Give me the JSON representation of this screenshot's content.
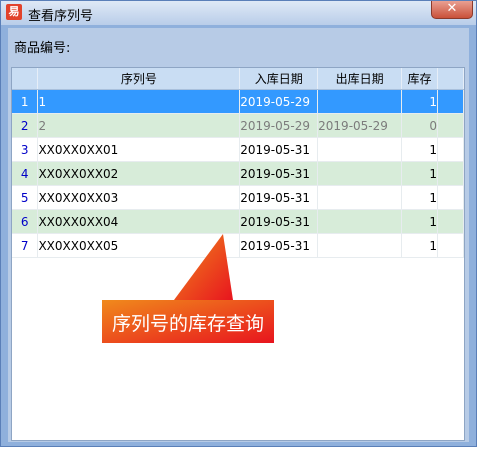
{
  "window": {
    "title": "查看序列号",
    "app_icon_glyph": "易",
    "close_glyph": "✕"
  },
  "form": {
    "product_label": "商品编号:"
  },
  "grid": {
    "columns": [
      "",
      "序列号",
      "入库日期",
      "出库日期",
      "库存"
    ],
    "rows": [
      {
        "index": "1",
        "serial": "1",
        "in_date": "2019-05-29",
        "out_date": "",
        "stock": "1",
        "state": "selected"
      },
      {
        "index": "2",
        "serial": "2",
        "in_date": "2019-05-29",
        "out_date": "2019-05-29",
        "stock": "0",
        "state": "dim-alt"
      },
      {
        "index": "3",
        "serial": "XX0XX0XX01",
        "in_date": "2019-05-31",
        "out_date": "",
        "stock": "1",
        "state": "normal"
      },
      {
        "index": "4",
        "serial": "XX0XX0XX02",
        "in_date": "2019-05-31",
        "out_date": "",
        "stock": "1",
        "state": "alt"
      },
      {
        "index": "5",
        "serial": "XX0XX0XX03",
        "in_date": "2019-05-31",
        "out_date": "",
        "stock": "1",
        "state": "normal"
      },
      {
        "index": "6",
        "serial": "XX0XX0XX04",
        "in_date": "2019-05-31",
        "out_date": "",
        "stock": "1",
        "state": "alt"
      },
      {
        "index": "7",
        "serial": "XX0XX0XX05",
        "in_date": "2019-05-31",
        "out_date": "",
        "stock": "1",
        "state": "normal"
      }
    ]
  },
  "annotation": {
    "text": "序列号的库存查询",
    "color_start": "#f08a1c",
    "color_end": "#e8141e"
  },
  "colors": {
    "selection": "#3399ff",
    "alt_row": "#d7ecd9",
    "header": "#c9ddf3"
  }
}
